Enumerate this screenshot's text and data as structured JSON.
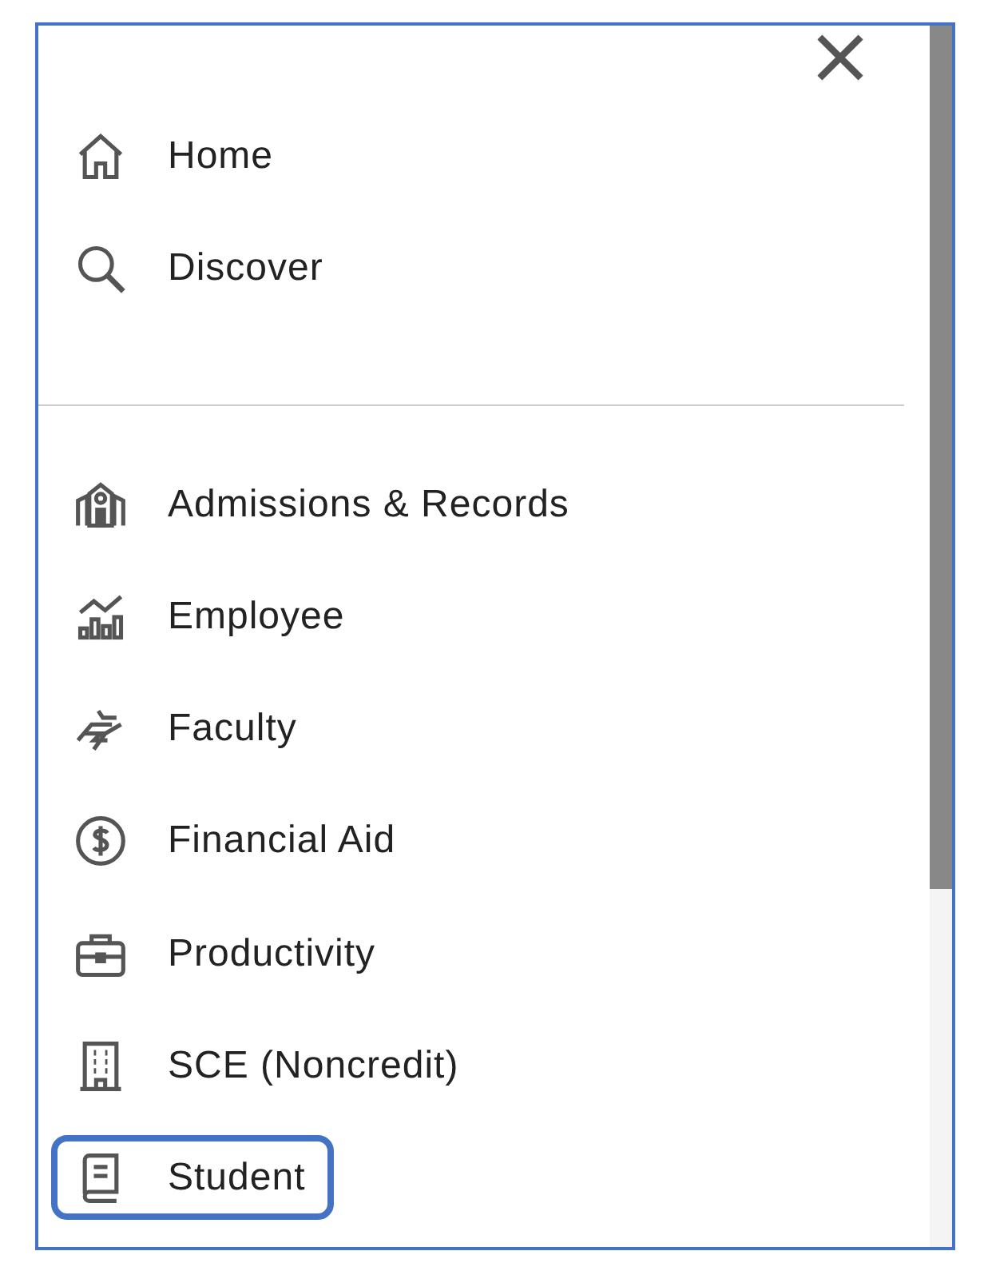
{
  "top_items": [
    {
      "label": "Home",
      "highlighted": false
    },
    {
      "label": "Discover",
      "highlighted": false
    }
  ],
  "categories": [
    {
      "label": "Admissions & Records",
      "highlighted": false
    },
    {
      "label": "Employee",
      "highlighted": false
    },
    {
      "label": "Faculty",
      "highlighted": false
    },
    {
      "label": "Financial Aid",
      "highlighted": false
    },
    {
      "label": "Productivity",
      "highlighted": false
    },
    {
      "label": "SCE (Noncredit)",
      "highlighted": false
    },
    {
      "label": "Student",
      "highlighted": true
    }
  ]
}
